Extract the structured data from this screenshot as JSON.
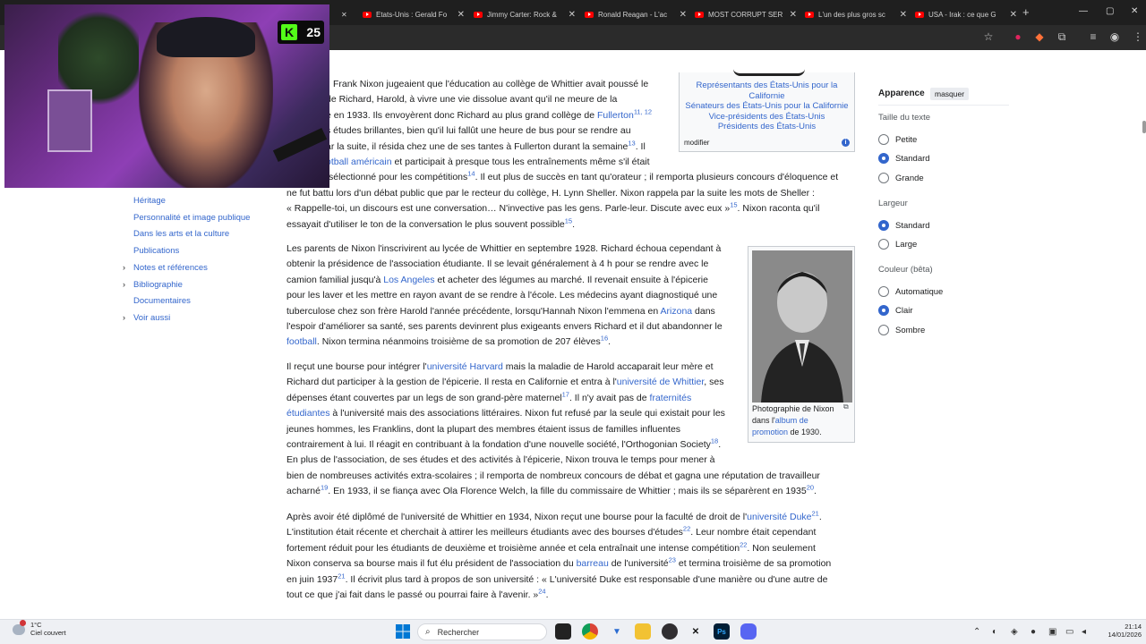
{
  "browser": {
    "tabs": [
      {
        "label": "Etats-Unis : Gerald Fo"
      },
      {
        "label": "Jimmy Carter: Rock &"
      },
      {
        "label": "Ronald Reagan - L'ac"
      },
      {
        "label": "MOST CORRUPT SER"
      },
      {
        "label": "L'un des plus gros sc"
      },
      {
        "label": "USA - Irak : ce que G"
      }
    ],
    "tab_close": "✕",
    "new_tab": "+"
  },
  "webcam": {
    "badge_letter": "K",
    "badge_count": "25"
  },
  "toc": {
    "items": [
      {
        "label": "Héritage",
        "expandable": false
      },
      {
        "label": "Personnalité et image publique",
        "expandable": false
      },
      {
        "label": "Dans les arts et la culture",
        "expandable": false
      },
      {
        "label": "Publications",
        "expandable": false
      },
      {
        "label": "Notes et références",
        "expandable": true
      },
      {
        "label": "Bibliographie",
        "expandable": true
      },
      {
        "label": "Documentaires",
        "expandable": false
      },
      {
        "label": "Voir aussi",
        "expandable": true
      }
    ]
  },
  "infobox": {
    "links": [
      "Représentants des États-Unis pour la",
      "Californie",
      "Sénateurs des États-Unis pour la Californie",
      "Vice-présidents des États-Unis",
      "Présidents des États-Unis"
    ],
    "modify": "modifier",
    "info_icon": "i"
  },
  "thumb": {
    "caption_1": "Photographie de Nixon",
    "caption_2": "dans l'",
    "caption_link_1": "album de",
    "caption_link_2": "promotion",
    "caption_3": " de 1930."
  },
  "article": {
    "p1": [
      {
        "t": "Frank Nixon jugeaient que l'éducation au collège de Whittier avait poussé le"
      },
      {
        "t": "de Richard, Harold, à vivre une vie dissolue avant qu'il ne meure de la"
      },
      {
        "t": "e en 1933. Ils envoyèrent donc Richard au plus grand collège de ",
        "link": "Fullerton",
        "sup": "11, 12"
      },
      {
        "t": "s études brillantes, bien qu'il lui fallût une heure de bus pour se rendre au"
      },
      {
        "t": "ar la suite, il résida chez une de ses tantes à Fullerton durant la semaine",
        "sup": "13",
        "t2": ". Il"
      },
      {
        "link": "otball américain",
        "t": " et participait à presque tous les entraînements même s'il était"
      },
      {
        "t": "sélectionné pour les compétitions",
        "sup": "14",
        "t2": ". Il eut plus de succès en tant qu'orateur ; il remporta plusieurs concours d'éloquence et"
      },
      {
        "t": "ne fut battu lors d'un débat public que par le recteur du collège, H. Lynn Sheller. Nixon rappela par la suite les mots de Sheller :"
      },
      {
        "t": "« Rappelle-toi, un discours est une conversation… N'invective pas les gens. Parle-leur. Discute avec eux »",
        "sup": "15",
        "t2": ". Nixon raconta qu'il"
      },
      {
        "t": "essayait d'utiliser le ton de la conversation le plus souvent possible",
        "sup": "15",
        "t2": "."
      }
    ],
    "p2": [
      {
        "t": "Les parents de Nixon l'inscrivirent au lycée de Whittier en septembre 1928. Richard échoua cependant à"
      },
      {
        "t": "obtenir la présidence de l'association étudiante. Il se levait généralement à 4 h pour se rendre avec le"
      },
      {
        "t": "camion familial jusqu'à ",
        "link": "Los Angeles",
        "t2": " et acheter des légumes au marché. Il revenait ensuite à l'épicerie"
      },
      {
        "t": "pour les laver et les mettre en rayon avant de se rendre à l'école. Les médecins ayant diagnostiqué une"
      },
      {
        "t": "tuberculose chez son frère Harold l'année précédente, lorsqu'Hannah Nixon l'emmena en ",
        "link": "Arizona",
        "t2": " dans"
      },
      {
        "t": "l'espoir d'améliorer sa santé, ses parents devinrent plus exigeants envers Richard et il dut abandonner le"
      },
      {
        "link": "football",
        "t": ". Nixon termina néanmoins troisième de sa promotion de 207 élèves",
        "sup": "16",
        "t2": "."
      }
    ],
    "p3": [
      {
        "t": "Il reçut une bourse pour intégrer l'",
        "link": "université Harvard",
        "t2": " mais la maladie de Harold accaparait leur mère et"
      },
      {
        "t": "Richard dut participer à la gestion de l'épicerie. Il resta en Californie et entra à l'",
        "link": "université de Whittier",
        "t2": ", ses"
      },
      {
        "t": "dépenses étant couvertes par un legs de son grand-père maternel",
        "sup": "17",
        "t2": ". Il n'y avait pas de ",
        "link2": "fraternités"
      },
      {
        "link": "étudiantes",
        "t": " à l'université mais des associations littéraires. Nixon fut refusé par la seule qui existait pour les"
      },
      {
        "t": "jeunes hommes, les Franklins, dont la plupart des membres étaient issus de familles influentes"
      },
      {
        "t": "contrairement à lui. Il réagit en contribuant à la fondation d'une nouvelle société, l'Orthogonian Society",
        "sup": "18",
        "t2": "."
      },
      {
        "t": "En plus de l'association, de ses études et des activités à l'épicerie, Nixon trouva le temps pour mener à"
      },
      {
        "t": "bien de nombreuses activités extra-scolaires ; il remporta de nombreux concours de débat et gagna une réputation de travailleur"
      },
      {
        "t": "acharné",
        "sup": "19",
        "t2": ". En 1933, il se fiança avec Ola Florence Welch, la fille du commissaire de Whittier ; mais ils se séparèrent en 1935",
        "sup2": "20",
        "t3": "."
      }
    ],
    "p4": [
      {
        "t": "Après avoir été diplômé de l'université de Whittier en 1934, Nixon reçut une bourse pour la faculté de droit de l'",
        "link": "université Duke",
        "sup": "21",
        "t2": "."
      },
      {
        "t": "L'institution était récente et cherchait à attirer les meilleurs étudiants avec des bourses d'études",
        "sup": "22",
        "t2": ". Leur nombre était cependant"
      },
      {
        "t": "fortement réduit pour les étudiants de deuxième et troisième année et cela entraînait une intense compétition",
        "sup": "22",
        "t2": ". Non seulement"
      },
      {
        "t": "Nixon conserva sa bourse mais il fut élu président de l'association du ",
        "link": "barreau",
        "t2": " de l'université",
        "sup": "23",
        "t3": " et termina troisième de sa promotion"
      },
      {
        "t": "en juin 1937",
        "sup": "21",
        "t2": ". Il écrivit plus tard à propos de son université : « L'université Duke est responsable d'une manière ou d'une autre de"
      },
      {
        "t": "tout ce que j'ai fait dans le passé ou pourrai faire à l'avenir. »",
        "sup": "24",
        "t2": "."
      }
    ]
  },
  "panel": {
    "title": "Apparence",
    "hide": "masquer",
    "text_size": {
      "heading": "Taille du texte",
      "options": [
        "Petite",
        "Standard",
        "Grande"
      ],
      "selected": "Standard"
    },
    "width": {
      "heading": "Largeur",
      "options": [
        "Standard",
        "Large"
      ],
      "selected": "Standard"
    },
    "color": {
      "heading": "Couleur (bêta)",
      "options": [
        "Automatique",
        "Clair",
        "Sombre"
      ],
      "selected": "Clair"
    }
  },
  "taskbar": {
    "weather_temp": "1°C",
    "weather_desc": "Ciel couvert",
    "search_placeholder": "Rechercher",
    "time": "21:14",
    "date": "14/01/2026"
  }
}
